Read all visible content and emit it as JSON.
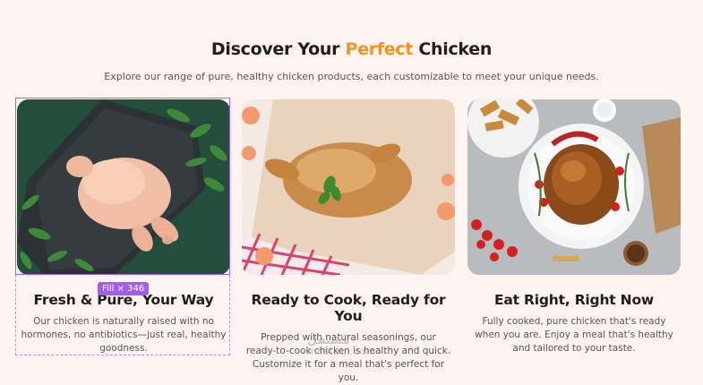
{
  "header": {
    "title_pre": "Discover Your ",
    "title_accent": "Perfect",
    "title_post": " Chicken",
    "subtitle": "Explore our range of pure, healthy chicken products, each customizable to meet your unique needs."
  },
  "cards": [
    {
      "heading": "Fresh & Pure, Your Way",
      "desc": "Our chicken is naturally raised with no hormones, no antibiotics—just real, healthy goodness.",
      "image": "raw-chicken-on-slate-photo"
    },
    {
      "heading": "Ready to Cook, Ready for You",
      "desc": "Prepped with natural seasonings, our ready-to-cook chicken is healthy and quick. Customize it for a meal that's perfect for you.",
      "image": "roasted-chicken-on-board-photo"
    },
    {
      "heading": "Eat Right, Right Now",
      "desc": "Fully cooked, pure chicken that's ready when you are. Enjoy a meal that's healthy and tailored to your taste.",
      "image": "roast-chicken-platter-photo"
    }
  ],
  "selection": {
    "fill_label": "Fill × 346"
  },
  "watermark": {
    "line1": "مستقل",
    "line2": "mostaql.com"
  },
  "colors": {
    "accent": "#f29422",
    "selection": "#a25cf0",
    "background": "#fdf3f1"
  }
}
